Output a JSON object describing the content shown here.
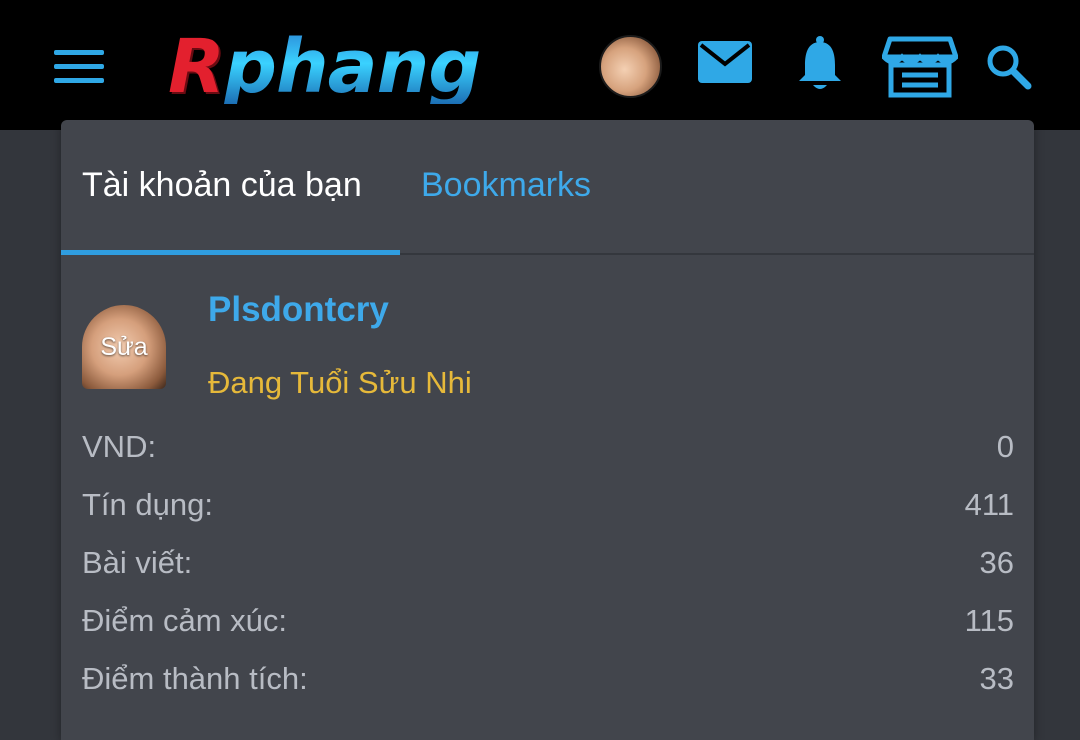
{
  "header": {
    "logo_first": "R",
    "logo_rest": "phang",
    "icons": [
      "menu-icon",
      "user-avatar",
      "mail-icon",
      "bell-icon",
      "store-icon",
      "search-icon"
    ],
    "accent_color": "#2fa8e6"
  },
  "account_menu": {
    "tabs": [
      {
        "label": "Tài khoản của bạn",
        "active": true
      },
      {
        "label": "Bookmarks",
        "active": false
      }
    ],
    "user": {
      "avatar_edit_label": "Sửa",
      "username": "Plsdontcry",
      "title": "Đang Tuổi Sửu Nhi"
    },
    "stats": [
      {
        "label": "VND:",
        "value": "0"
      },
      {
        "label": "Tín dụng:",
        "value": "411"
      },
      {
        "label": "Bài viết:",
        "value": "36"
      },
      {
        "label": "Điểm cảm xúc:",
        "value": "115"
      },
      {
        "label": "Điểm thành tích:",
        "value": "33"
      }
    ]
  }
}
